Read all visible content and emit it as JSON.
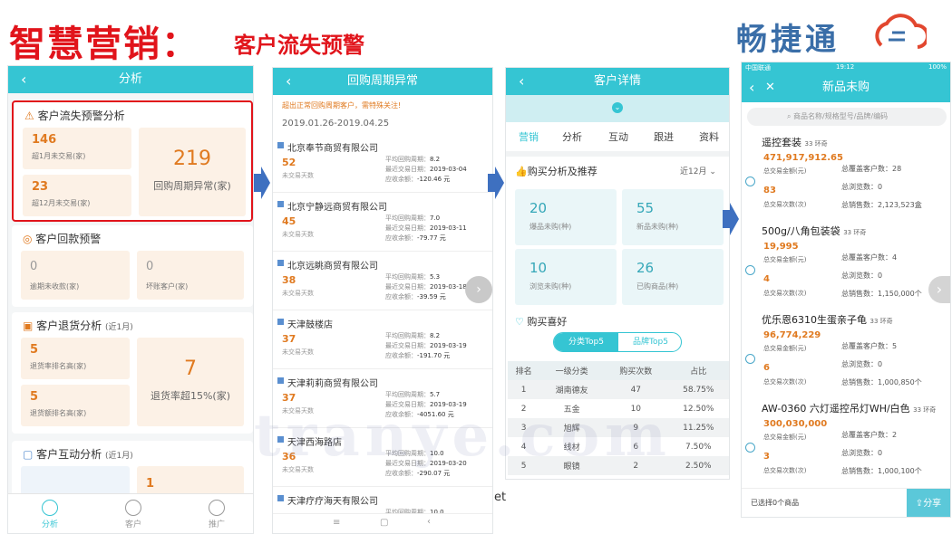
{
  "slide": {
    "title": "智慧营销：",
    "subtitle": "客户流失预警",
    "logo": "畅捷通",
    "watermark": "tranye.com",
    "stray_text": "et"
  },
  "colors": {
    "accent": "#35c5d3",
    "highlight": "#e1141b",
    "value": "#e07a20"
  },
  "p1": {
    "header": "分析",
    "card1": {
      "title": "客户流失预警分析",
      "s1": {
        "value": "146",
        "label": "超1月未交易(家)"
      },
      "s2": {
        "value": "23",
        "label": "超12月未交易(家)"
      },
      "big": {
        "value": "219",
        "label": "回购周期异常(家)"
      }
    },
    "card2": {
      "title": "客户回款预警",
      "s1": {
        "value": "0",
        "label": "逾期未收款(家)"
      },
      "s2": {
        "value": "0",
        "label": "坏账客户(家)"
      }
    },
    "card3": {
      "title": "客户退货分析",
      "suffix": "(近1月)",
      "s1": {
        "value": "5",
        "label": "退货率排名高(家)"
      },
      "s2": {
        "value": "5",
        "label": "退货额排名高(家)"
      },
      "big": {
        "value": "7",
        "label": "退货率超15%(家)"
      }
    },
    "card4": {
      "title": "客户互动分析",
      "suffix": "(近1月)",
      "s1": {
        "value": "1"
      }
    },
    "tabs": [
      "分析",
      "客户",
      "推广"
    ]
  },
  "p2": {
    "header": "回购周期异常",
    "notice": "超出正常回购周期客户，需特殊关注!",
    "daterange": "2019.01.26-2019.04.25",
    "k1": "平均回购周期：",
    "k2": "最近交易日期：",
    "k3": "应收余额：",
    "daylabel": "未交易天数",
    "rows": [
      {
        "name": "北京奉节商贸有限公司",
        "days": "52",
        "cycle": "8.2",
        "date": "2019-03-04",
        "bal": "-120.46 元"
      },
      {
        "name": "北京宁静远商贸有限公司",
        "days": "45",
        "cycle": "7.0",
        "date": "2019-03-11",
        "bal": "-79.77 元"
      },
      {
        "name": "北京远眺商贸有限公司",
        "days": "38",
        "cycle": "5.3",
        "date": "2019-03-18",
        "bal": "-39.59 元"
      },
      {
        "name": "天津鼓楼店",
        "days": "37",
        "cycle": "8.2",
        "date": "2019-03-19",
        "bal": "-191.70 元"
      },
      {
        "name": "天津莉莉商贸有限公司",
        "days": "37",
        "cycle": "5.7",
        "date": "2019-03-19",
        "bal": "-4051.60 元"
      },
      {
        "name": "天津西海路店",
        "days": "36",
        "cycle": "10.0",
        "date": "2019-03-20",
        "bal": "-290.07 元"
      },
      {
        "name": "天津疗疗海天有限公司",
        "days": "",
        "cycle": "10.0",
        "date": "",
        "bal": ""
      }
    ]
  },
  "p3": {
    "header": "客户详情",
    "tabs": [
      "营销",
      "分析",
      "互动",
      "跟进",
      "资料"
    ],
    "section1": "购买分析及推荐",
    "period": "近12月",
    "tiles": [
      {
        "value": "20",
        "label": "爆品未购(种)"
      },
      {
        "value": "55",
        "label": "新品未购(种)"
      },
      {
        "value": "10",
        "label": "浏览未购(种)"
      },
      {
        "value": "26",
        "label": "已购商品(种)"
      }
    ],
    "section2": "购买喜好",
    "seg": [
      "分类Top5",
      "品牌Top5"
    ],
    "cols": [
      "排名",
      "一级分类",
      "购买次数",
      "占比"
    ],
    "rank": [
      [
        "1",
        "湖南德友",
        "47",
        "58.75%"
      ],
      [
        "2",
        "五金",
        "10",
        "12.50%"
      ],
      [
        "3",
        "旭辉",
        "9",
        "11.25%"
      ],
      [
        "4",
        "线材",
        "6",
        "7.50%"
      ],
      [
        "5",
        "眼镜",
        "2",
        "2.50%"
      ]
    ]
  },
  "p4": {
    "status": {
      "carrier": "中国联通",
      "time": "19:12",
      "battery": "100%"
    },
    "header": "新品未购",
    "search": "商品名称/规格型号/品牌/编码",
    "k1": "总交易金额(元)",
    "k2": "总交易次数(次)",
    "k3": "总覆盖客户数：",
    "k4": "总浏览数：",
    "k5": "总销售数：",
    "products": [
      {
        "name": "遥控套装",
        "hot": "33 环奇",
        "amount": "471,917,912.65",
        "times": "83",
        "cust": "28",
        "views": "0",
        "sales": "2,123,523盒"
      },
      {
        "name": "500g/八角包装袋",
        "hot": "33 环奇",
        "amount": "19,995",
        "times": "4",
        "cust": "4",
        "views": "0",
        "sales": "1,150,000个"
      },
      {
        "name": "优乐恩6310生蛋亲子龟",
        "hot": "33 环奇",
        "amount": "96,774,229",
        "times": "6",
        "cust": "5",
        "views": "0",
        "sales": "1,000,850个"
      },
      {
        "name": "AW-0360 六灯遥控吊灯WH/白色",
        "hot": "33 环奇",
        "amount": "300,030,000",
        "times": "3",
        "cust": "2",
        "views": "0",
        "sales": "1,000,100个"
      }
    ],
    "footer": "已选择0个商品",
    "share": "分享"
  }
}
